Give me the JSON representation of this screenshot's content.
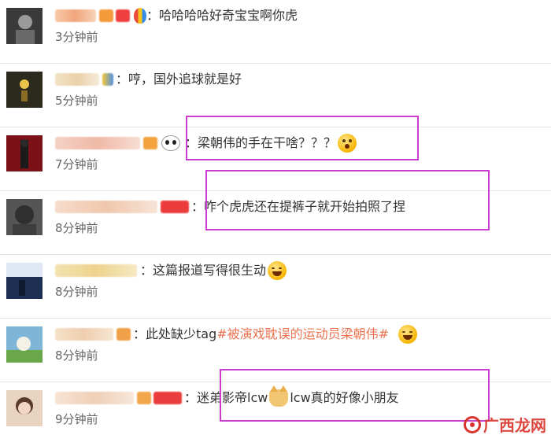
{
  "comments": [
    {
      "text": "：哈哈哈哈好奇宝宝啊你虎",
      "time": "3分钟前"
    },
    {
      "text": "：哼，国外追球就是好",
      "time": "5分钟前"
    },
    {
      "text": "：梁朝伟的手在干啥？？？",
      "time": "7分钟前"
    },
    {
      "text": "：咋个虎虎还在提裤子就开始拍照了捏",
      "time": "8分钟前"
    },
    {
      "text": "：这篇报道写得很生动",
      "time": "8分钟前"
    },
    {
      "text": "：此处缺少tag ",
      "topic": "#被演戏耽误的运动员梁朝伟#",
      "time": "8分钟前"
    },
    {
      "text_before": "：迷弟影帝lcw",
      "text_after": " lcw真的好像小朋友",
      "time": "9分钟前"
    }
  ],
  "watermark": {
    "text": "广西龙网"
  },
  "colors": {
    "highlight": "#c93ccf",
    "topic": "#eb7350",
    "time": "#666666",
    "watermark": "#d9342b"
  }
}
